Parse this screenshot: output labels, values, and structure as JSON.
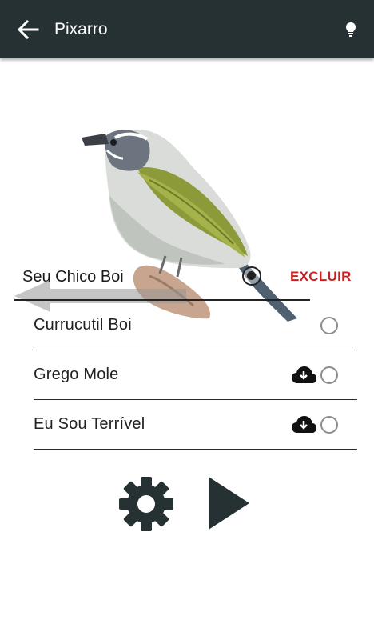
{
  "header": {
    "title": "Pixarro",
    "back_icon": "arrow-left-icon",
    "action_icon": "lightbulb-icon"
  },
  "swiped_item": {
    "label": "Seu Chico Boi",
    "delete_label": "EXCLUIR",
    "selected": true,
    "delete_color": "#cc1f1f"
  },
  "songs": [
    {
      "label": "Currucutil Boi",
      "downloadable": false,
      "selected": false
    },
    {
      "label": "Grego Mole",
      "downloadable": true,
      "selected": false
    },
    {
      "label": "Eu Sou Terrível",
      "downloadable": true,
      "selected": false
    }
  ],
  "controls": {
    "settings_icon": "gear-icon",
    "play_icon": "play-icon"
  },
  "colors": {
    "appbar": "#263133",
    "icons": "#263133",
    "accent_delete": "#cc1f1f"
  }
}
